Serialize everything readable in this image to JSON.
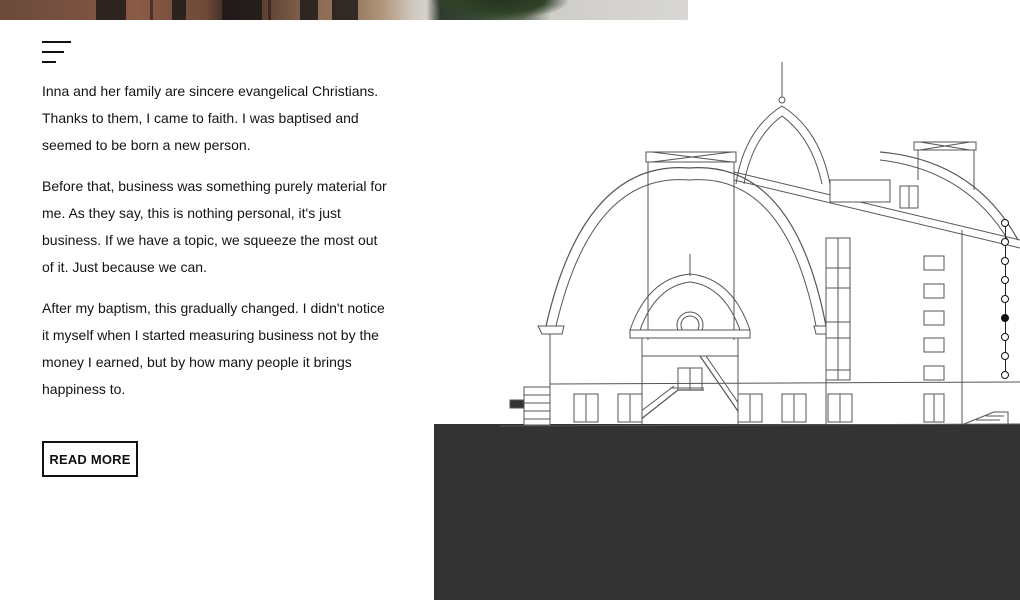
{
  "header": {
    "menu_icon": "hamburger-menu-icon"
  },
  "story": {
    "paragraphs": [
      "Inna and her family are sincere evangelical Christians. Thanks to them, I came to faith. I was baptised and seemed to be born a new person.",
      "Before that, business was something purely material for me. As they say, this is nothing personal, it's just business. If we have a topic, we squeeze the most out of it. Just because we can.",
      "After my baptism, this gradually changed. I didn't notice it myself when I started measuring business not by the money I earned, but by how many people it brings happiness to."
    ],
    "read_more_label": "READ MORE"
  },
  "slider": {
    "total": 9,
    "active_index": 5
  },
  "colors": {
    "ground": "#333333",
    "text": "#141414",
    "line": "#555555"
  }
}
